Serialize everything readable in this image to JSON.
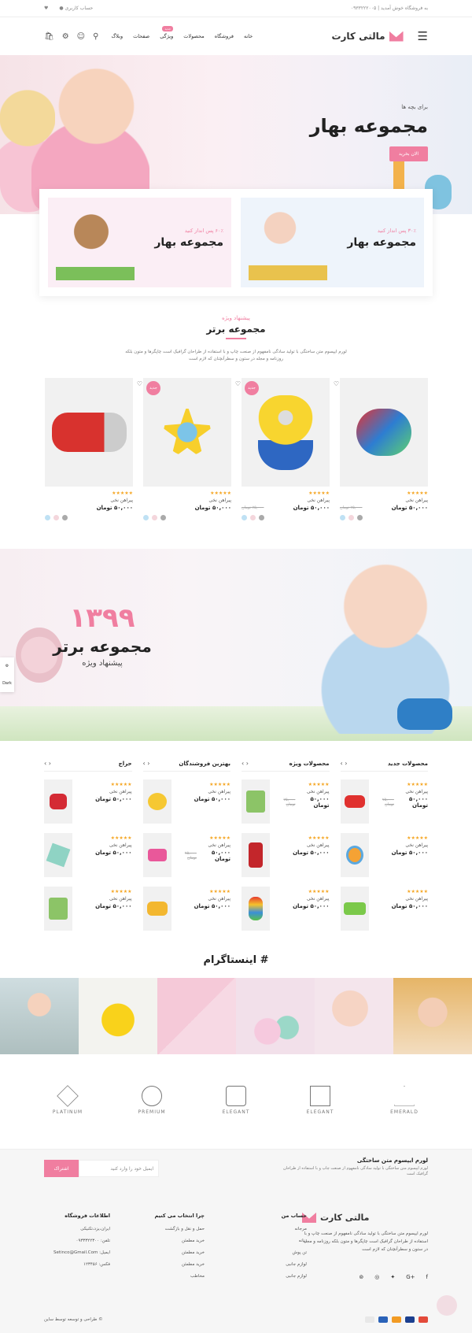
{
  "topbar": {
    "welcome": "به فروشگاه خوش آمدید",
    "phone": "۰۹۳۳۲۲۲۰۰۵",
    "account": "حساب کاربری"
  },
  "header": {
    "logo": "مالتی کارت",
    "menu": [
      "خانه",
      "فروشگاه",
      "محصولات",
      "ویژگی",
      "صفحات",
      "وبلاگ"
    ],
    "new_badge": "جدید"
  },
  "hero": {
    "subtitle": "برای بچه ها",
    "title": "مجموعه بهار",
    "button": "الان بخرید"
  },
  "promo": [
    {
      "off": "۳۰٪ پس انداز کنید",
      "name": "مجموعه بهار"
    },
    {
      "off": "۶۰٪ پس انداز کنید",
      "name": "مجموعه بهار"
    }
  ],
  "featured": {
    "kicker": "پیشنهاد ویژه",
    "title": "مجموعه برتر",
    "desc": "لورم ایپسوم متن ساختگی با تولید سادگی نامفهوم از صنعت چاپ و با استفاده از طراحان گرافیک است چاپگرها و متون بلکه روزنامه و مجله در ستون و سطرآنچنان که لازم است"
  },
  "products": [
    {
      "name": "پیراهن نخی",
      "price": "۵۰,۰۰۰ تومان",
      "old": "۷۵,۰۰۰ تومان",
      "badge": "",
      "stars": "★★★★★"
    },
    {
      "name": "پیراهن نخی",
      "price": "۵۰,۰۰۰ تومان",
      "old": "۷۵,۰۰۰ تومان",
      "badge": "جدید",
      "stars": "★★★★★"
    },
    {
      "name": "پیراهن نخی",
      "price": "۵۰,۰۰۰ تومان",
      "old": "",
      "badge": "جدید",
      "stars": "★★★★★"
    },
    {
      "name": "پیراهن نخی",
      "price": "۵۰,۰۰۰ تومان",
      "old": "",
      "badge": "",
      "stars": "★★★★★"
    }
  ],
  "banner2": {
    "year": "۱۳۹۹",
    "title": "مجموعه برتر",
    "subtitle": "پیشنهاد ویژه"
  },
  "sidetab": {
    "label": "Dark"
  },
  "lists": [
    {
      "title": "محصولات جدید",
      "items": [
        {
          "name": "پیراهن نخی",
          "price": "۵۰,۰۰۰ تومان",
          "old": "۷۵,۰۰۰ تومان"
        },
        {
          "name": "پیراهن نخی",
          "price": "۵۰,۰۰۰ تومان",
          "old": ""
        },
        {
          "name": "پیراهن نخی",
          "price": "۵۰,۰۰۰ تومان",
          "old": ""
        }
      ]
    },
    {
      "title": "محصولات ویژه",
      "items": [
        {
          "name": "پیراهن نخی",
          "price": "۵۰,۰۰۰ تومان",
          "old": "۷۵,۰۰۰ تومان"
        },
        {
          "name": "پیراهن نخی",
          "price": "۵۰,۰۰۰ تومان",
          "old": ""
        },
        {
          "name": "پیراهن نخی",
          "price": "۵۰,۰۰۰ تومان",
          "old": ""
        }
      ]
    },
    {
      "title": "بهترین فروشندگان",
      "items": [
        {
          "name": "پیراهن نخی",
          "price": "۵۰,۰۰۰ تومان",
          "old": ""
        },
        {
          "name": "پیراهن نخی",
          "price": "۵۰,۰۰۰ تومان",
          "old": "۷۵,۰۰۰ تومان"
        },
        {
          "name": "پیراهن نخی",
          "price": "۵۰,۰۰۰ تومان",
          "old": ""
        }
      ]
    },
    {
      "title": "حراج",
      "items": [
        {
          "name": "پیراهن نخی",
          "price": "۵۰,۰۰۰ تومان",
          "old": ""
        },
        {
          "name": "پیراهن نخی",
          "price": "۵۰,۰۰۰ تومان",
          "old": ""
        },
        {
          "name": "پیراهن نخی",
          "price": "۵۰,۰۰۰ تومان",
          "old": ""
        }
      ]
    }
  ],
  "instagram": {
    "title": "# اینستاگرام"
  },
  "brands": [
    "EMERALD",
    "ELEGANT",
    "ELEGANT",
    "PREMIUM",
    "PLATINUM"
  ],
  "newsletter": {
    "title": "لورم ایپسوم متن ساختگی",
    "desc": "لورم ایپسوم متن ساختگی با تولید سادگی نامفهوم از صنعت چاپ و با استفاده از طراحان گرافیک است",
    "placeholder": "ایمیل خود را وارد کنید",
    "button": "اشتراک"
  },
  "footer": {
    "logo": "مالتی کارت",
    "about": "لورم ایپسوم متن ساختگی با تولید سادگی نامفهوم از صنعت چاپ و با استفاده از طراحان گرافیک است چاپگرها و متون بلکه روزنامه و مجله در ستون و سطرآنچنان که لازم است",
    "account": {
      "title": "حساب من",
      "items": [
        "مرجانه",
        "زنانه",
        "تن پوش",
        "لوازم جانبی",
        "لوازم جانبی"
      ]
    },
    "why": {
      "title": "چرا انتخاب می کنیم",
      "items": [
        "حمل و نقل و بازگشت",
        "خرید مطمئن",
        "خرید مطمئن",
        "خرید مطمئن",
        "مخاطب"
      ]
    },
    "info": {
      "title": "اطلاعات فروشگاه",
      "items": [
        "ایران،یزد،تکنیکی",
        "تلفن: ۰۹۳۳۳۲۲۳۰۰",
        "ایمیل: Setinco@Gmail.Com",
        "فکس: ۱۲۳۴۵۶"
      ]
    },
    "copyright": "© طراحی و توسعه توسط ساین"
  }
}
